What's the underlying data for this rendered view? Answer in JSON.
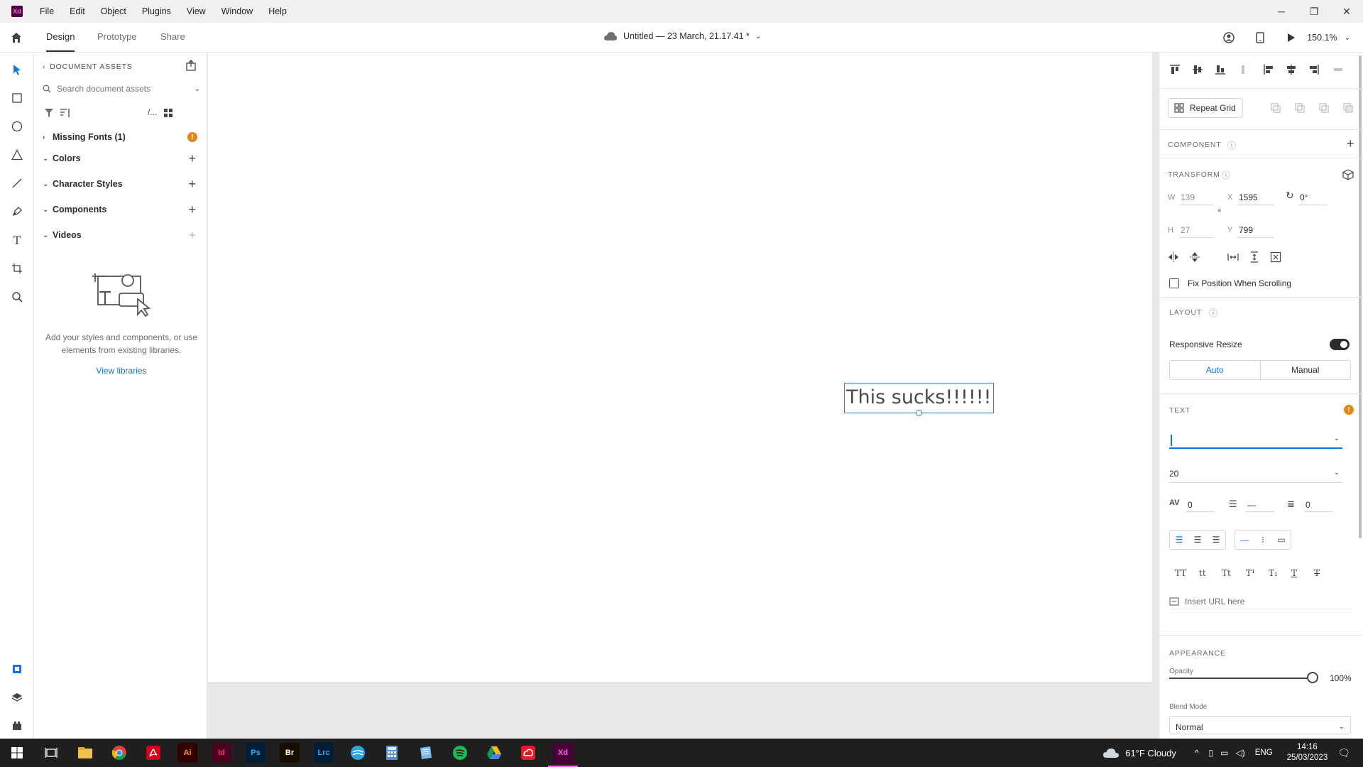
{
  "app": {
    "logo": "Xd",
    "menu": [
      "File",
      "Edit",
      "Object",
      "Plugins",
      "View",
      "Window",
      "Help"
    ]
  },
  "toolbar": {
    "tabs": [
      "Design",
      "Prototype",
      "Share"
    ],
    "doc_title": "Untitled — 23 March, 21.17.41 *",
    "zoom": "150.1%"
  },
  "assets": {
    "header": "DOCUMENT ASSETS",
    "search_placeholder": "Search document assets",
    "sections": {
      "missing_fonts": "Missing Fonts (1)",
      "colors": "Colors",
      "character_styles": "Character Styles",
      "components": "Components",
      "videos": "Videos"
    },
    "empty_text": "Add your styles and components, or use elements from existing libraries.",
    "view_libraries": "View libraries"
  },
  "canvas": {
    "text_content": "This sucks!!!!!!!!!"
  },
  "inspector": {
    "repeat_grid": "Repeat Grid",
    "component_label": "COMPONENT",
    "transform_label": "TRANSFORM",
    "w_label": "W",
    "w_value": "139",
    "h_label": "H",
    "h_value": "27",
    "x_label": "X",
    "x_value": "1595",
    "y_label": "Y",
    "y_value": "799",
    "rotation": "0°",
    "fix_position": "Fix Position When Scrolling",
    "layout_label": "LAYOUT",
    "responsive_resize": "Responsive Resize",
    "layout_auto": "Auto",
    "layout_manual": "Manual",
    "text_label": "TEXT",
    "font_size": "20",
    "char_spacing": "0",
    "line_spacing": "—",
    "para_spacing": "0",
    "insert_url": "Insert URL here",
    "appearance_label": "APPEARANCE",
    "opacity_label": "Opacity",
    "opacity_value": "100%",
    "blend_label": "Blend Mode",
    "blend_value": "Normal",
    "accent_color": "#1473e6",
    "warning_color": "#e68619",
    "transform_buttons": [
      "TT",
      "tt",
      "Tt",
      "T¹",
      "T₁",
      "T",
      "T"
    ]
  },
  "taskbar": {
    "apps": [
      "Ai",
      "Id",
      "Ps",
      "Br",
      "Lrc",
      "Xd"
    ],
    "weather": "61°F  Cloudy",
    "lang": "ENG",
    "time": "14:16",
    "date": "25/03/2023"
  }
}
